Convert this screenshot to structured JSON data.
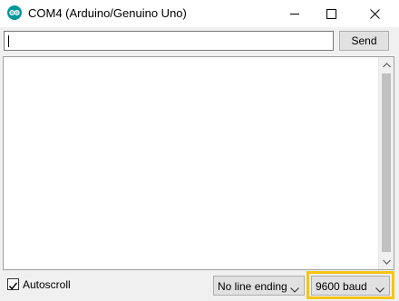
{
  "window": {
    "title": "COM4 (Arduino/Genuino Uno)",
    "app_icon": "arduino-icon"
  },
  "send_row": {
    "input_value": "",
    "send_label": "Send"
  },
  "output": {
    "text": ""
  },
  "bottom_bar": {
    "autoscroll_label": "Autoscroll",
    "autoscroll_checked": true,
    "line_ending_value": "No line ending",
    "baud_value": "9600 baud"
  },
  "colors": {
    "highlight": "#f5c518",
    "arduino_teal": "#00979c"
  }
}
